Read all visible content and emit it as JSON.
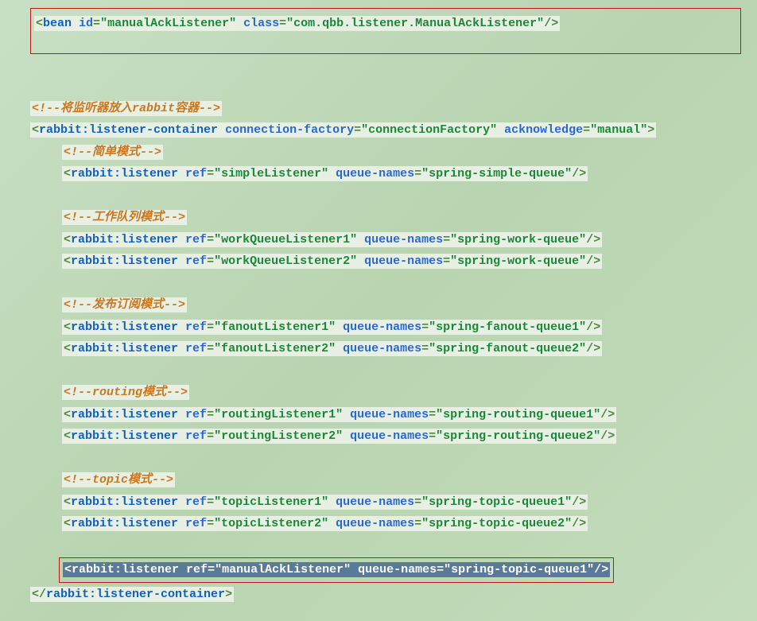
{
  "bean": {
    "open": "<",
    "tag": "bean",
    "idAttr": " id",
    "eq": "=",
    "idVal": "\"manualAckListener\"",
    "classAttr": " class",
    "classVal": "\"com.qbb.listener.ManualAckListener\"",
    "close": "/>"
  },
  "comment1": "<!--将监听器放入rabbit容器-->",
  "container": {
    "open": "<",
    "tag": "rabbit:listener-container",
    "attr1": " connection-factory",
    "eq": "=",
    "val1": "\"connectionFactory\"",
    "attr2": " acknowledge",
    "val2": "\"manual\"",
    "close": ">",
    "closeTag": "</",
    "closeTagName": "rabbit:listener-container",
    "closeEnd": ">"
  },
  "sections": {
    "simple": {
      "comment": "<!--简单模式-->",
      "line1": {
        "open": "<",
        "tag": "rabbit:listener",
        "refAttr": " ref",
        "eq": "=",
        "refVal": "\"simpleListener\"",
        "qnAttr": " queue-names",
        "qnVal": "\"spring-simple-queue\"",
        "close": "/>"
      }
    },
    "work": {
      "comment": "<!--工作队列模式-->",
      "line1": {
        "open": "<",
        "tag": "rabbit:listener",
        "refAttr": " ref",
        "eq": "=",
        "refVal": "\"workQueueListener1\"",
        "qnAttr": " queue-names",
        "qnVal": "\"spring-work-queue\"",
        "close": "/>"
      },
      "line2": {
        "open": "<",
        "tag": "rabbit:listener",
        "refAttr": " ref",
        "eq": "=",
        "refVal": "\"workQueueListener2\"",
        "qnAttr": " queue-names",
        "qnVal": "\"spring-work-queue\"",
        "close": "/>"
      }
    },
    "fanout": {
      "comment": "<!--发布订阅模式-->",
      "line1": {
        "open": "<",
        "tag": "rabbit:listener",
        "refAttr": " ref",
        "eq": "=",
        "refVal": "\"fanoutListener1\"",
        "qnAttr": " queue-names",
        "qnVal": "\"spring-fanout-queue1\"",
        "close": "/>"
      },
      "line2": {
        "open": "<",
        "tag": "rabbit:listener",
        "refAttr": " ref",
        "eq": "=",
        "refVal": "\"fanoutListener2\"",
        "qnAttr": " queue-names",
        "qnVal": "\"spring-fanout-queue2\"",
        "close": "/>"
      }
    },
    "routing": {
      "comment": "<!--routing模式-->",
      "line1": {
        "open": "<",
        "tag": "rabbit:listener",
        "refAttr": " ref",
        "eq": "=",
        "refVal": "\"routingListener1\"",
        "qnAttr": " queue-names",
        "qnVal": "\"spring-routing-queue1\"",
        "close": "/>"
      },
      "line2": {
        "open": "<",
        "tag": "rabbit:listener",
        "refAttr": " ref",
        "eq": "=",
        "refVal": "\"routingListener2\"",
        "qnAttr": " queue-names",
        "qnVal": "\"spring-routing-queue2\"",
        "close": "/>"
      }
    },
    "topic": {
      "comment": "<!--topic模式-->",
      "line1": {
        "open": "<",
        "tag": "rabbit:listener",
        "refAttr": " ref",
        "eq": "=",
        "refVal": "\"topicListener1\"",
        "qnAttr": " queue-names",
        "qnVal": "\"spring-topic-queue1\"",
        "close": "/>"
      },
      "line2": {
        "open": "<",
        "tag": "rabbit:listener",
        "refAttr": " ref",
        "eq": "=",
        "refVal": "\"topicListener2\"",
        "qnAttr": " queue-names",
        "qnVal": "\"spring-topic-queue2\"",
        "close": "/>"
      }
    },
    "manual": {
      "line1": {
        "open": "<",
        "tag": "rabbit:listener",
        "refAttr": " ref",
        "eq": "=",
        "refVal": "\"manualAckListener\"",
        "qnAttr": " queue-names",
        "qnVal": "\"spring-topic-queue1\"",
        "close": "/>"
      }
    }
  }
}
